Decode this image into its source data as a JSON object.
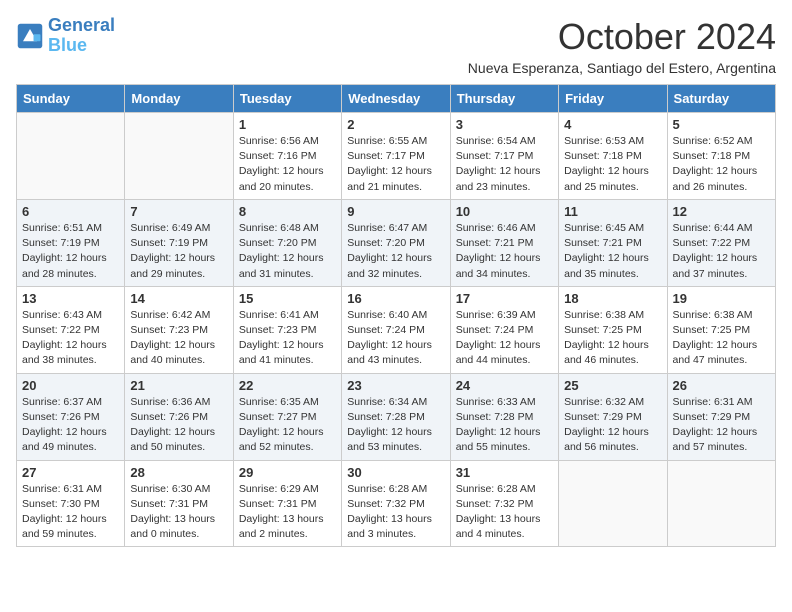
{
  "logo": {
    "line1": "General",
    "line2": "Blue"
  },
  "title": "October 2024",
  "subtitle": "Nueva Esperanza, Santiago del Estero, Argentina",
  "days_header": [
    "Sunday",
    "Monday",
    "Tuesday",
    "Wednesday",
    "Thursday",
    "Friday",
    "Saturday"
  ],
  "weeks": [
    [
      {
        "day": "",
        "info": ""
      },
      {
        "day": "",
        "info": ""
      },
      {
        "day": "1",
        "info": "Sunrise: 6:56 AM\nSunset: 7:16 PM\nDaylight: 12 hours and 20 minutes."
      },
      {
        "day": "2",
        "info": "Sunrise: 6:55 AM\nSunset: 7:17 PM\nDaylight: 12 hours and 21 minutes."
      },
      {
        "day": "3",
        "info": "Sunrise: 6:54 AM\nSunset: 7:17 PM\nDaylight: 12 hours and 23 minutes."
      },
      {
        "day": "4",
        "info": "Sunrise: 6:53 AM\nSunset: 7:18 PM\nDaylight: 12 hours and 25 minutes."
      },
      {
        "day": "5",
        "info": "Sunrise: 6:52 AM\nSunset: 7:18 PM\nDaylight: 12 hours and 26 minutes."
      }
    ],
    [
      {
        "day": "6",
        "info": "Sunrise: 6:51 AM\nSunset: 7:19 PM\nDaylight: 12 hours and 28 minutes."
      },
      {
        "day": "7",
        "info": "Sunrise: 6:49 AM\nSunset: 7:19 PM\nDaylight: 12 hours and 29 minutes."
      },
      {
        "day": "8",
        "info": "Sunrise: 6:48 AM\nSunset: 7:20 PM\nDaylight: 12 hours and 31 minutes."
      },
      {
        "day": "9",
        "info": "Sunrise: 6:47 AM\nSunset: 7:20 PM\nDaylight: 12 hours and 32 minutes."
      },
      {
        "day": "10",
        "info": "Sunrise: 6:46 AM\nSunset: 7:21 PM\nDaylight: 12 hours and 34 minutes."
      },
      {
        "day": "11",
        "info": "Sunrise: 6:45 AM\nSunset: 7:21 PM\nDaylight: 12 hours and 35 minutes."
      },
      {
        "day": "12",
        "info": "Sunrise: 6:44 AM\nSunset: 7:22 PM\nDaylight: 12 hours and 37 minutes."
      }
    ],
    [
      {
        "day": "13",
        "info": "Sunrise: 6:43 AM\nSunset: 7:22 PM\nDaylight: 12 hours and 38 minutes."
      },
      {
        "day": "14",
        "info": "Sunrise: 6:42 AM\nSunset: 7:23 PM\nDaylight: 12 hours and 40 minutes."
      },
      {
        "day": "15",
        "info": "Sunrise: 6:41 AM\nSunset: 7:23 PM\nDaylight: 12 hours and 41 minutes."
      },
      {
        "day": "16",
        "info": "Sunrise: 6:40 AM\nSunset: 7:24 PM\nDaylight: 12 hours and 43 minutes."
      },
      {
        "day": "17",
        "info": "Sunrise: 6:39 AM\nSunset: 7:24 PM\nDaylight: 12 hours and 44 minutes."
      },
      {
        "day": "18",
        "info": "Sunrise: 6:38 AM\nSunset: 7:25 PM\nDaylight: 12 hours and 46 minutes."
      },
      {
        "day": "19",
        "info": "Sunrise: 6:38 AM\nSunset: 7:25 PM\nDaylight: 12 hours and 47 minutes."
      }
    ],
    [
      {
        "day": "20",
        "info": "Sunrise: 6:37 AM\nSunset: 7:26 PM\nDaylight: 12 hours and 49 minutes."
      },
      {
        "day": "21",
        "info": "Sunrise: 6:36 AM\nSunset: 7:26 PM\nDaylight: 12 hours and 50 minutes."
      },
      {
        "day": "22",
        "info": "Sunrise: 6:35 AM\nSunset: 7:27 PM\nDaylight: 12 hours and 52 minutes."
      },
      {
        "day": "23",
        "info": "Sunrise: 6:34 AM\nSunset: 7:28 PM\nDaylight: 12 hours and 53 minutes."
      },
      {
        "day": "24",
        "info": "Sunrise: 6:33 AM\nSunset: 7:28 PM\nDaylight: 12 hours and 55 minutes."
      },
      {
        "day": "25",
        "info": "Sunrise: 6:32 AM\nSunset: 7:29 PM\nDaylight: 12 hours and 56 minutes."
      },
      {
        "day": "26",
        "info": "Sunrise: 6:31 AM\nSunset: 7:29 PM\nDaylight: 12 hours and 57 minutes."
      }
    ],
    [
      {
        "day": "27",
        "info": "Sunrise: 6:31 AM\nSunset: 7:30 PM\nDaylight: 12 hours and 59 minutes."
      },
      {
        "day": "28",
        "info": "Sunrise: 6:30 AM\nSunset: 7:31 PM\nDaylight: 13 hours and 0 minutes."
      },
      {
        "day": "29",
        "info": "Sunrise: 6:29 AM\nSunset: 7:31 PM\nDaylight: 13 hours and 2 minutes."
      },
      {
        "day": "30",
        "info": "Sunrise: 6:28 AM\nSunset: 7:32 PM\nDaylight: 13 hours and 3 minutes."
      },
      {
        "day": "31",
        "info": "Sunrise: 6:28 AM\nSunset: 7:32 PM\nDaylight: 13 hours and 4 minutes."
      },
      {
        "day": "",
        "info": ""
      },
      {
        "day": "",
        "info": ""
      }
    ]
  ]
}
